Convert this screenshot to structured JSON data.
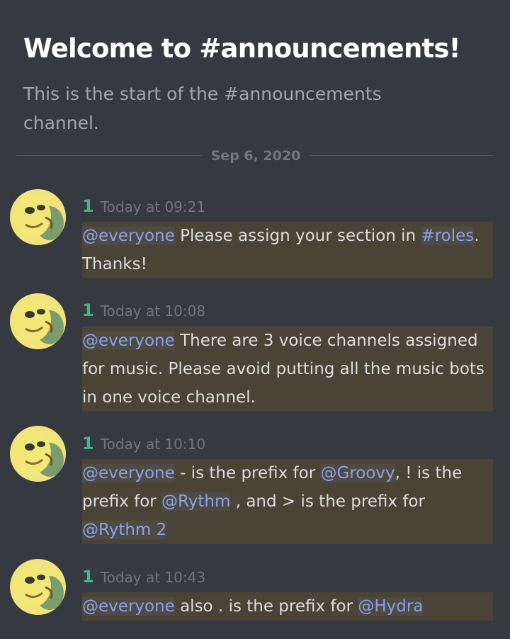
{
  "welcome": {
    "title": "Welcome to #announcements!",
    "subtitle": "This is the start of the #announcements channel."
  },
  "date_divider": "Sep 6, 2020",
  "messages": [
    {
      "username": "1",
      "timestamp": "Today at 09:21",
      "parts": [
        {
          "text": "@everyone",
          "mention": true
        },
        {
          "text": " Please assign your section in ",
          "mention": false
        },
        {
          "text": "#roles",
          "mention": true
        },
        {
          "text": ". Thanks!",
          "mention": false
        }
      ]
    },
    {
      "username": "1",
      "timestamp": "Today at 10:08",
      "parts": [
        {
          "text": "@everyone",
          "mention": true
        },
        {
          "text": " There are 3 voice channels assigned for music. Please avoid putting all the music bots in one voice channel.",
          "mention": false
        }
      ]
    },
    {
      "username": "1",
      "timestamp": "Today at 10:10",
      "parts": [
        {
          "text": "@everyone",
          "mention": true
        },
        {
          "text": " - is the prefix for ",
          "mention": false
        },
        {
          "text": "@Groovy",
          "mention": true
        },
        {
          "text": ", ! is the prefix for ",
          "mention": false
        },
        {
          "text": "@Rythm",
          "mention": true
        },
        {
          "text": " , and > is the prefix for ",
          "mention": false
        },
        {
          "text": "@Rythm 2",
          "mention": true
        }
      ]
    },
    {
      "username": "1",
      "timestamp": "Today at 10:43",
      "parts": [
        {
          "text": "@everyone",
          "mention": true
        },
        {
          "text": " also . is the prefix for ",
          "mention": false
        },
        {
          "text": "@Hydra",
          "mention": true
        }
      ]
    }
  ],
  "colors": {
    "background": "#36393f",
    "username": "#43b581",
    "mention": "#8ea1e1",
    "mention_highlight": "#4a4436"
  },
  "icons": {
    "avatar": "yellow-cartoon-face-avatar"
  }
}
